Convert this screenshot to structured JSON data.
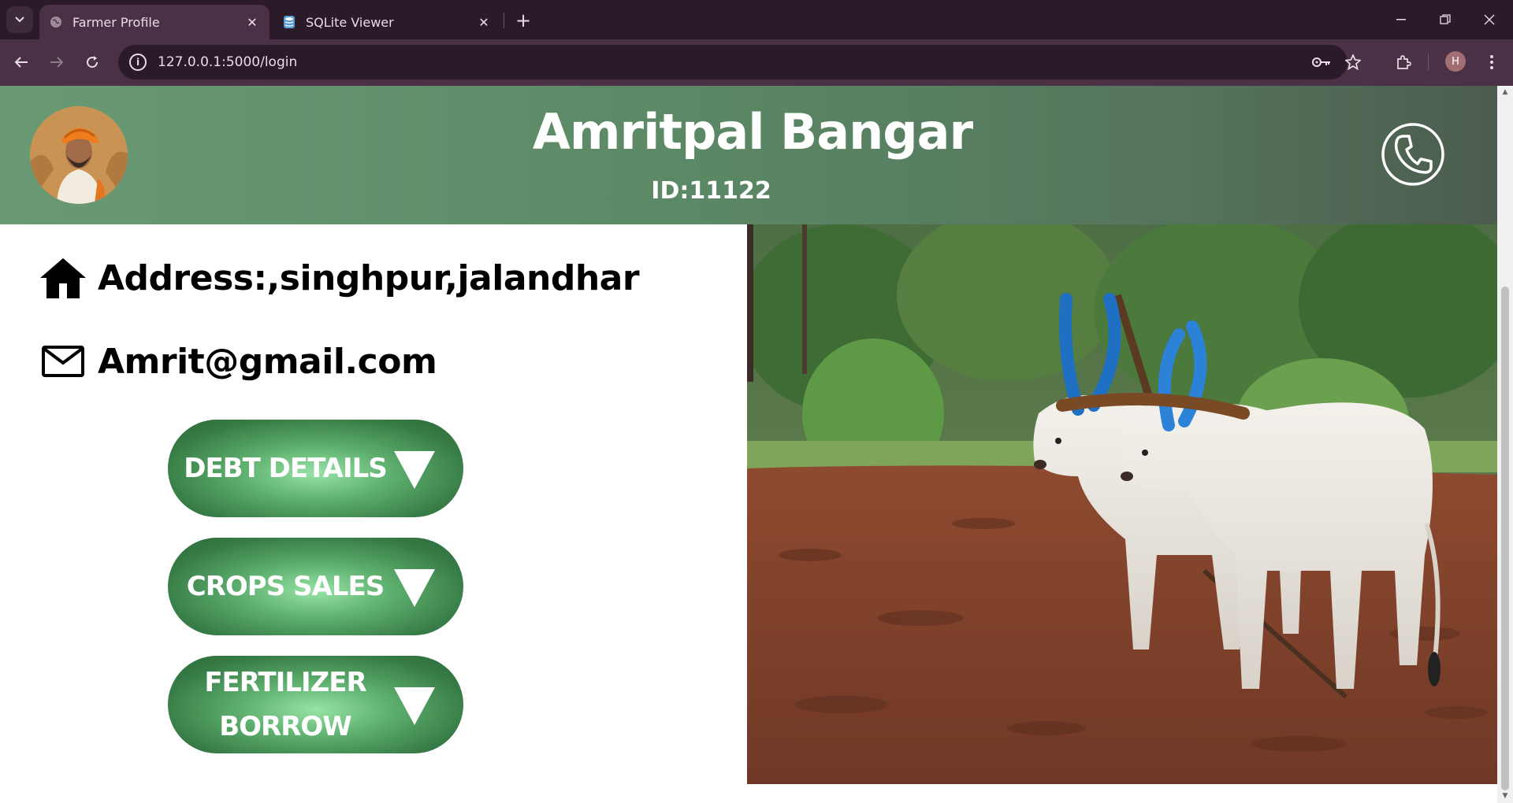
{
  "browser": {
    "tabs": [
      {
        "title": "Farmer Profile",
        "active": true
      },
      {
        "title": "SQLite Viewer",
        "active": false
      }
    ],
    "url": "127.0.0.1:5000/login",
    "profile_initial": "H"
  },
  "profile": {
    "name": "Amritpal Bangar",
    "id_text": "ID:11122",
    "address": "Address:,singhpur,jalandhar",
    "email": "Amrit@gmail.com"
  },
  "menu": [
    {
      "label": "DEBT DETAILS"
    },
    {
      "label": "CROPS SALES"
    },
    {
      "label_line1": "FERTILIZER",
      "label_line2": "BORROW"
    }
  ],
  "colors": {
    "header_green": "#5b8966",
    "button_green": "#367a45",
    "chrome_dark": "#2b1b29",
    "chrome_mid": "#4a3146"
  },
  "icons": [
    "home-icon",
    "mail-icon",
    "phone-icon",
    "triangle-down-icon"
  ]
}
